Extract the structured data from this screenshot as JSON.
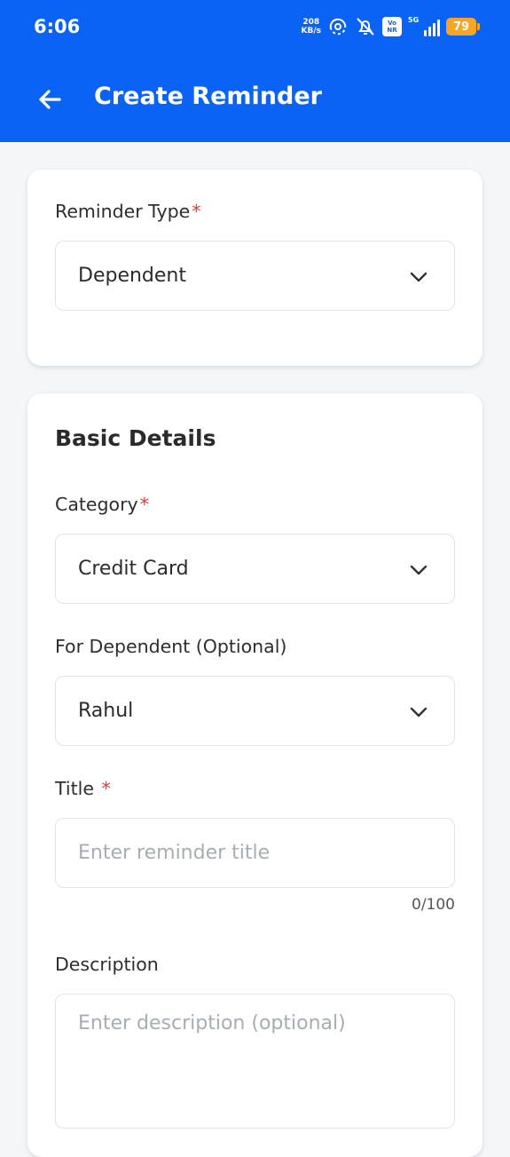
{
  "status_bar": {
    "time": "6:06",
    "net_speed_value": "208",
    "net_speed_unit": "KB/s",
    "volte_top": "Vo",
    "volte_bottom": "NR",
    "network": "5G",
    "battery": "79"
  },
  "header": {
    "title": "Create Reminder"
  },
  "reminder_type": {
    "label": "Reminder Type",
    "required_mark": "*",
    "value": "Dependent"
  },
  "basic_details": {
    "section_title": "Basic Details",
    "category": {
      "label": "Category",
      "required_mark": "*",
      "value": "Credit Card"
    },
    "dependent": {
      "label": "For Dependent (Optional)",
      "value": "Rahul"
    },
    "title_field": {
      "label": "Title",
      "required_mark": "*",
      "placeholder": "Enter reminder title",
      "value": "",
      "counter": "0/100"
    },
    "description": {
      "label": "Description",
      "placeholder": "Enter description (optional)",
      "value": ""
    }
  },
  "colors": {
    "primary": "#0b63f6",
    "required": "#e53935",
    "battery": "#f5a623"
  }
}
